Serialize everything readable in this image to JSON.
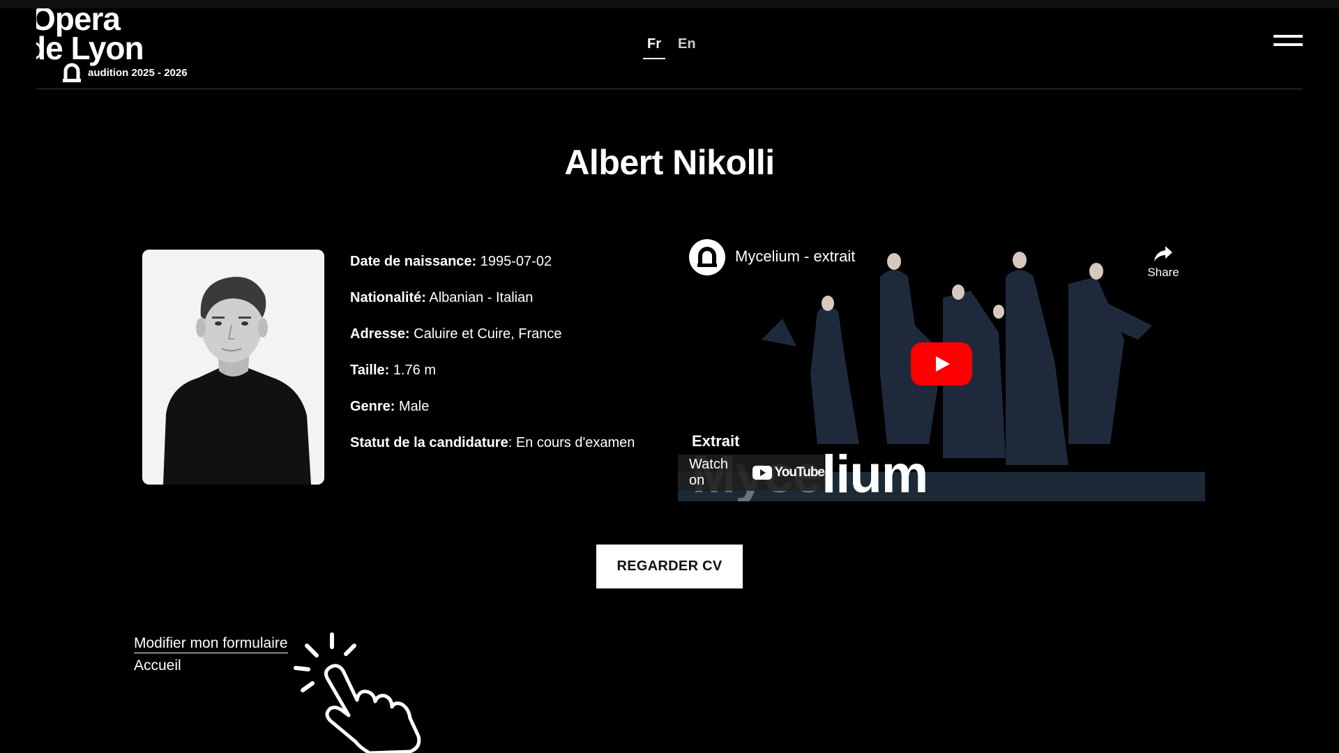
{
  "header": {
    "logo_line1": "Opera",
    "logo_line2": "de Lyon",
    "logo_subtitle": "audition 2025 - 2026",
    "languages": [
      {
        "label": "Fr",
        "active": true
      },
      {
        "label": "En",
        "active": false
      }
    ],
    "menu_icon": "hamburger-menu-icon"
  },
  "profile": {
    "name": "Albert Nikolli",
    "photo_alt": "portrait-photo",
    "details": [
      {
        "label": "Date de naissance:",
        "value": " 1995-07-02"
      },
      {
        "label": "Nationalité:",
        "value": " Albanian - Italian"
      },
      {
        "label": "Adresse:",
        "value": " Caluire et Cuire, France"
      },
      {
        "label": "Taille:",
        "value": " 1.76 m"
      },
      {
        "label": "Genre:",
        "value": " Male"
      },
      {
        "label": "Statut de la candidature",
        "value": ": En cours d'examen"
      }
    ]
  },
  "video": {
    "title": "Mycelium - extrait",
    "share_label": "Share",
    "overlay_label": "Extrait",
    "overlay_big_dim": "Myce",
    "overlay_big": "lium",
    "watch_on": "Watch on",
    "youtube_label": "YouTube"
  },
  "actions": {
    "cv_button": "REGARDER CV",
    "edit_link": "Modifier mon formulaire",
    "home_link": "Accueil"
  },
  "colors": {
    "background": "#000000",
    "text": "#ffffff",
    "youtube_red": "#ff0000"
  }
}
